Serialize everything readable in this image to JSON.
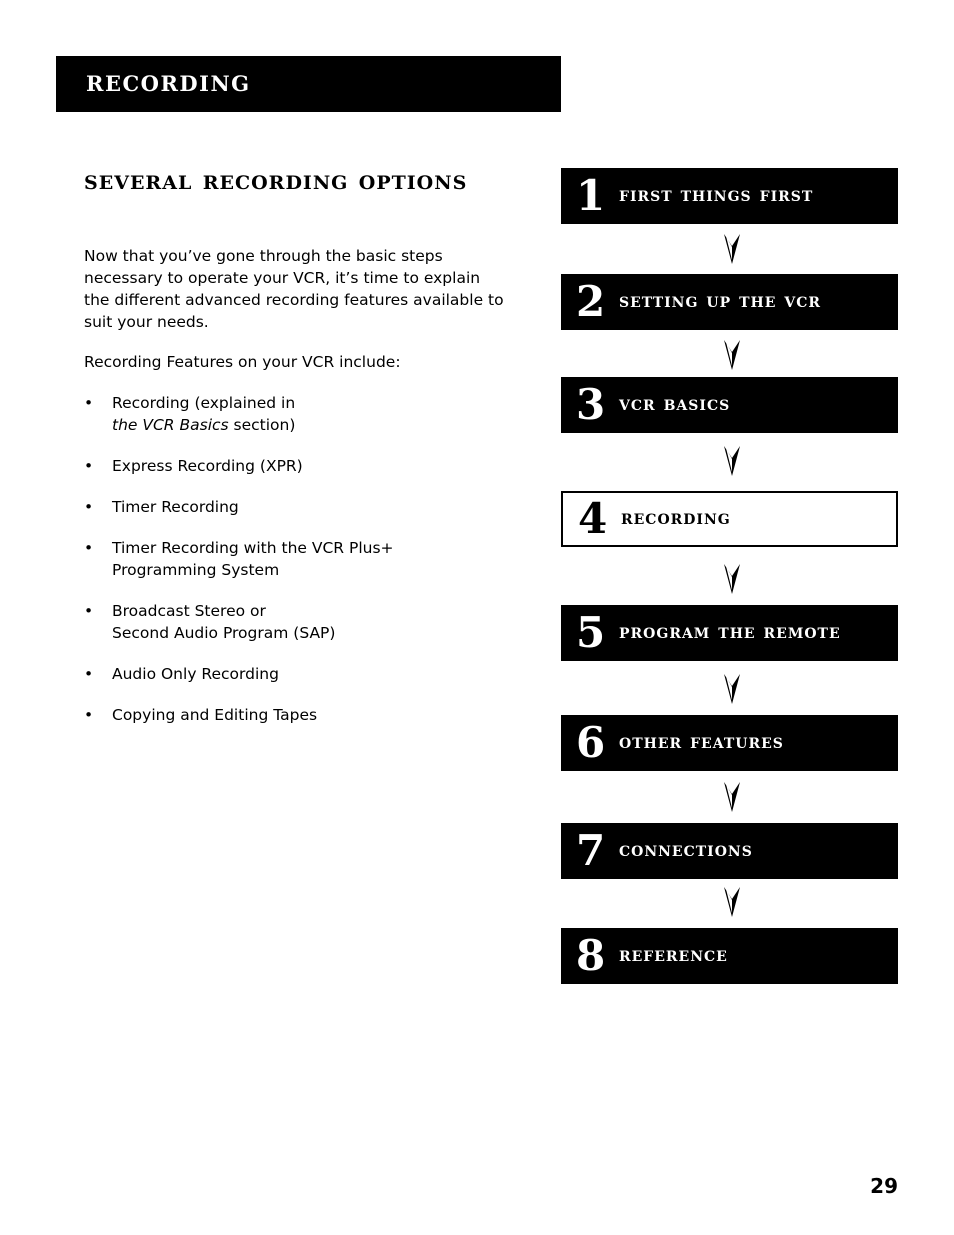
{
  "header": {
    "title": "Recording"
  },
  "section": {
    "title": "Several Recording Options",
    "intro": "Now that you’ve gone through the basic steps necessary to operate your VCR, it’s time to explain the different advanced recording features available to suit your needs.",
    "features_lead": "Recording Features on your VCR include:",
    "bullet": "•",
    "features": [
      {
        "text": "Recording (explained in",
        "line2_italic": "the VCR Basics",
        "line2_rest": " section)"
      },
      {
        "text": "Express Recording (XPR)"
      },
      {
        "text": "Timer Recording"
      },
      {
        "text": "Timer Recording with the VCR Plus+",
        "line2_rest": "Programming System"
      },
      {
        "text": "Broadcast Stereo or",
        "line2_rest": "Second Audio Program (SAP)"
      },
      {
        "text": "Audio Only Recording"
      },
      {
        "text": "Copying and Editing Tapes"
      }
    ]
  },
  "chapters": [
    {
      "number": "1",
      "label": "First Things First",
      "current": false
    },
    {
      "number": "2",
      "label": "Setting Up the VCR",
      "current": false
    },
    {
      "number": "3",
      "label": "VCR Basics",
      "current": false
    },
    {
      "number": "4",
      "label": "Recording",
      "current": true
    },
    {
      "number": "5",
      "label": "Program the Remote",
      "current": false
    },
    {
      "number": "6",
      "label": "Other Features",
      "current": false
    },
    {
      "number": "7",
      "label": "Connections",
      "current": false
    },
    {
      "number": "8",
      "label": "Reference",
      "current": false
    }
  ],
  "page_number": "29"
}
